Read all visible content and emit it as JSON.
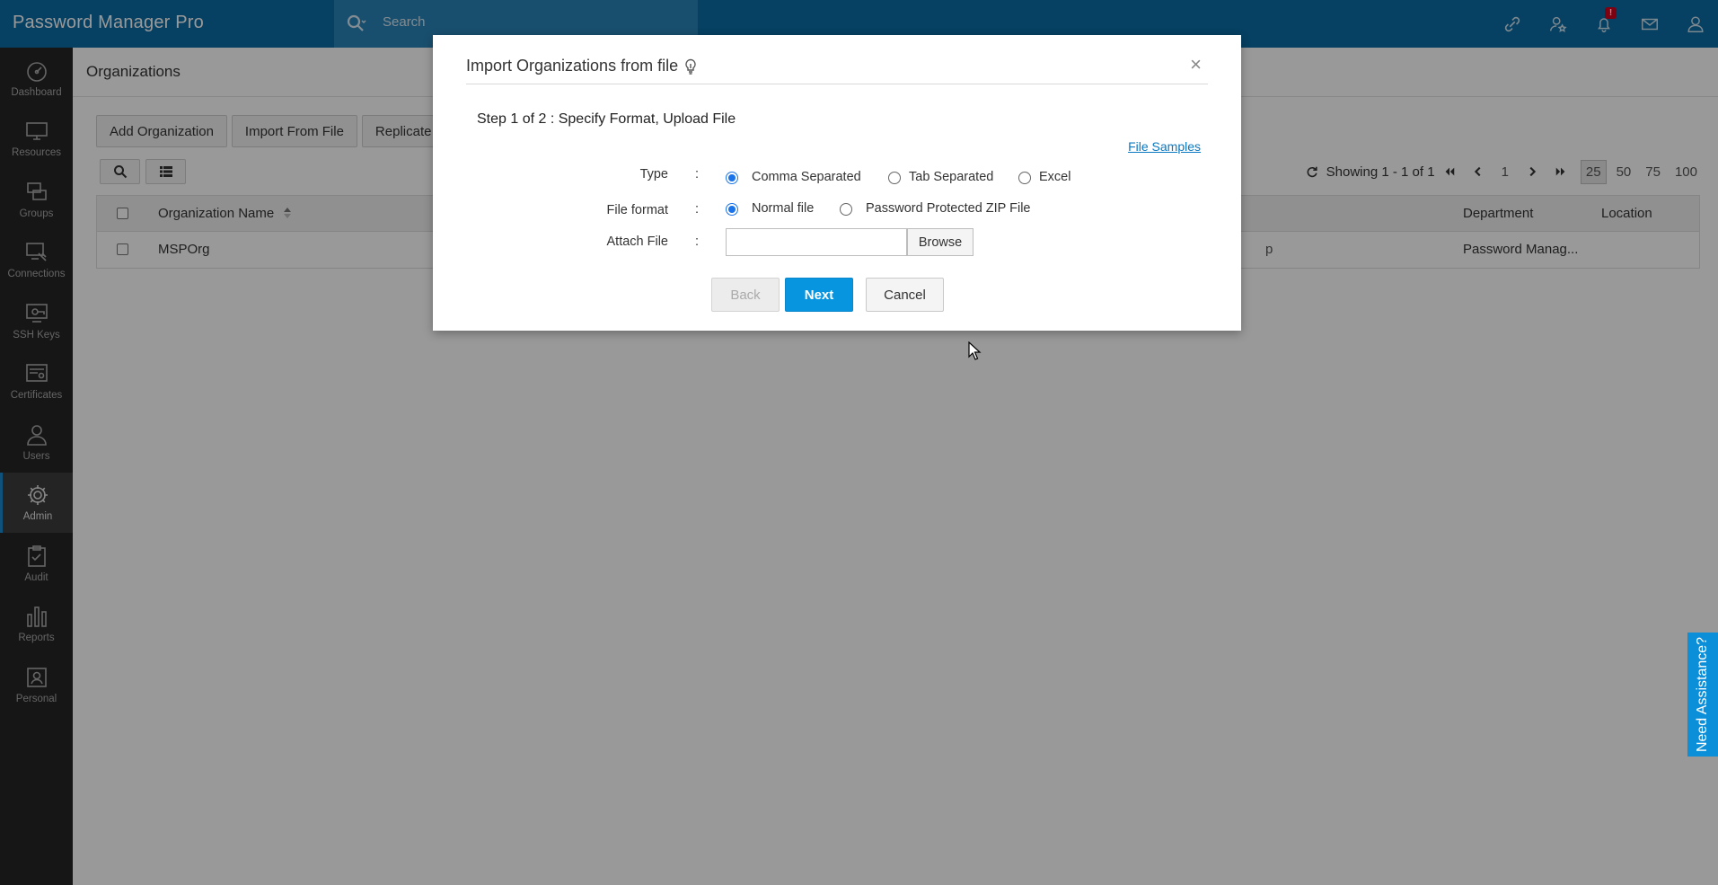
{
  "app": {
    "name": "Password Manager Pro",
    "name_main": "Password Manager Pr",
    "name_o": "o"
  },
  "search": {
    "placeholder": "Search"
  },
  "header": {
    "notification_badge": "!"
  },
  "sidebar": {
    "items": [
      {
        "label": "Dashboard",
        "icon": "dashboard-icon"
      },
      {
        "label": "Resources",
        "icon": "monitor-icon"
      },
      {
        "label": "Groups",
        "icon": "groups-icon"
      },
      {
        "label": "Connections",
        "icon": "connections-icon"
      },
      {
        "label": "SSH Keys",
        "icon": "ssh-key-icon"
      },
      {
        "label": "Certificates",
        "icon": "certificate-icon"
      },
      {
        "label": "Users",
        "icon": "user-icon"
      },
      {
        "label": "Admin",
        "icon": "gear-icon",
        "active": true
      },
      {
        "label": "Audit",
        "icon": "clipboard-check-icon"
      },
      {
        "label": "Reports",
        "icon": "bar-chart-icon"
      },
      {
        "label": "Personal",
        "icon": "personal-icon"
      }
    ]
  },
  "main": {
    "title": "Organizations",
    "actions": [
      "Add Organization",
      "Import From File",
      "Replicate"
    ],
    "pager": {
      "showing": "Showing 1 - 1 of 1",
      "page": "1",
      "sizes": [
        "25",
        "50",
        "75",
        "100"
      ],
      "selected_size": "25"
    },
    "table": {
      "columns": [
        "Organization Name",
        "Department",
        "Location"
      ],
      "rows": [
        {
          "name": "MSPOrg",
          "hidden_fragment": "p",
          "department": "Password Manag...",
          "location": ""
        }
      ]
    }
  },
  "modal": {
    "title": "Import Organizations from file",
    "close": "×",
    "step": "Step 1 of 2 : Specify Format, Upload File",
    "samples_link": "File Samples",
    "colon": ":",
    "type": {
      "label": "Type",
      "options": [
        "Comma Separated",
        "Tab Separated",
        "Excel"
      ],
      "selected": "Comma Separated"
    },
    "file_format": {
      "label": "File format",
      "options": [
        "Normal file",
        "Password Protected ZIP File"
      ],
      "selected": "Normal file"
    },
    "attach": {
      "label": "Attach File",
      "value": "",
      "browse": "Browse"
    },
    "buttons": {
      "back": "Back",
      "next": "Next",
      "cancel": "Cancel"
    }
  },
  "assist": {
    "label": "Need Assistance?"
  },
  "colors": {
    "topbar": "#0a6ba3",
    "sidebar": "#262626",
    "primary_button": "#0895e0",
    "assist_tab": "#0c8fd9"
  }
}
